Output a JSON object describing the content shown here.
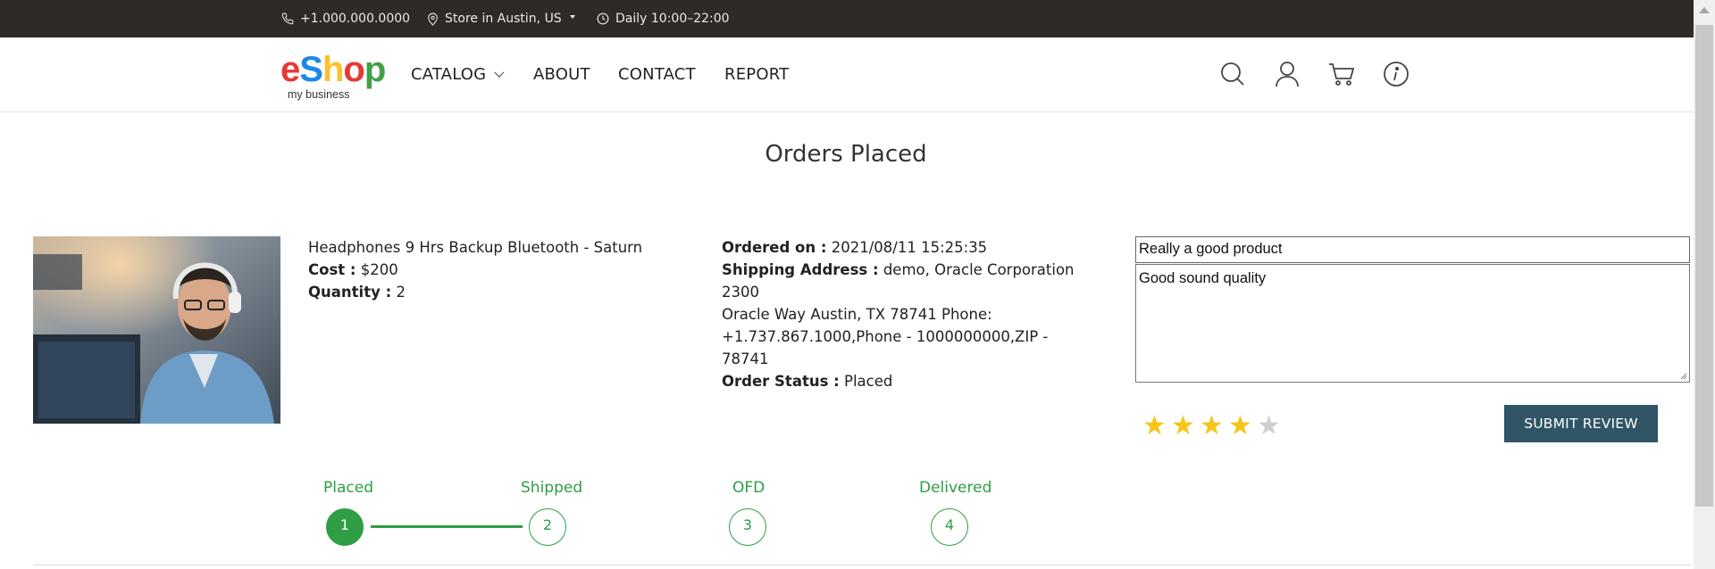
{
  "topbar": {
    "phone": "+1.000.000.0000",
    "store": "Store in Austin, US",
    "hours": "Daily 10:00–22:00"
  },
  "header": {
    "logo": {
      "letters": [
        "e",
        "S",
        "h",
        "o",
        "p"
      ],
      "letter_colors": [
        "#e53935",
        "#1e88e5",
        "#fbc02d",
        "#e53935",
        "#43a047"
      ],
      "tagline": "my business"
    },
    "nav": [
      "CATALOG",
      "ABOUT",
      "CONTACT",
      "REPORT"
    ],
    "icons": [
      "search-icon",
      "user-icon",
      "cart-icon",
      "info-icon"
    ]
  },
  "page": {
    "title": "Orders Placed"
  },
  "order": {
    "product_name": "Headphones 9 Hrs Backup Bluetooth - Saturn",
    "cost_label": "Cost :",
    "cost_value": "$200",
    "quantity_label": "Quantity :",
    "quantity_value": "2",
    "ordered_on_label": "Ordered on :",
    "ordered_on_value": "2021/08/11 15:25:35",
    "shipping_label": "Shipping Address :",
    "shipping_line1": "demo, Oracle Corporation 2300",
    "shipping_line2": "Oracle Way Austin, TX 78741 Phone:",
    "shipping_line3": "+1.737.867.1000,Phone - 1000000000,ZIP - 78741",
    "status_label": "Order Status :",
    "status_value": "Placed"
  },
  "review": {
    "title_value": "Really a good product",
    "body_value": "Good sound quality",
    "rating": 4,
    "rating_max": 5,
    "submit_label": "SUBMIT REVIEW",
    "star_color_on": "#f5c518",
    "star_color_off": "#cfcfcf"
  },
  "progress": {
    "steps": [
      {
        "label": "Placed",
        "number": "1"
      },
      {
        "label": "Shipped",
        "number": "2"
      },
      {
        "label": "OFD",
        "number": "3"
      },
      {
        "label": "Delivered",
        "number": "4"
      }
    ],
    "completed_steps": 1,
    "accent": "#2f9e44"
  }
}
